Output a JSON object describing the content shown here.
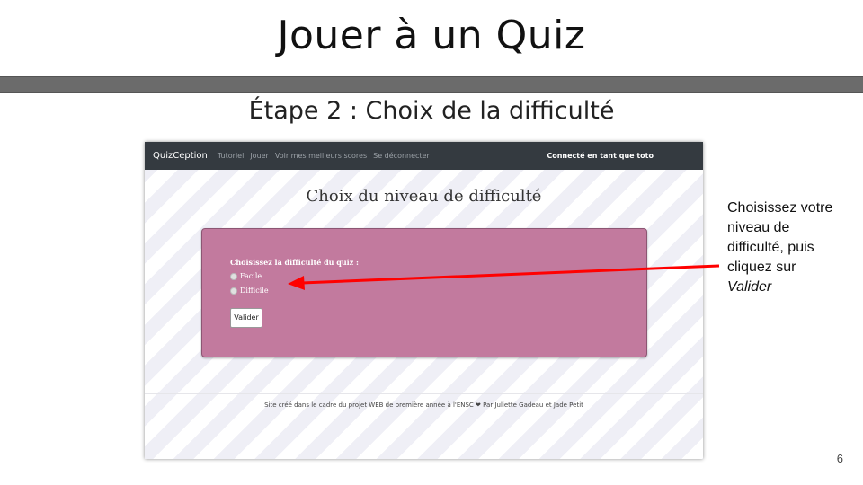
{
  "slide": {
    "title": "Jouer à un Quiz",
    "subtitle": "Étape 2 : Choix de la difficulté",
    "page_number": "6",
    "title_bar_color": "#6b6b6b"
  },
  "app": {
    "navbar": {
      "brand": "QuizCeption",
      "links": [
        "Tutoriel",
        "Jouer",
        "Voir mes meilleurs scores",
        "Se déconnecter"
      ],
      "user_status": "Connecté en tant que toto"
    },
    "heading": "Choix du niveau de difficulté",
    "panel": {
      "question": "Choisissez la difficulté du quiz :",
      "options": [
        "Facile",
        "Difficile"
      ],
      "submit_label": "Valider",
      "background_color": "#c27a9e"
    },
    "footer": "Site créé dans le cadre du projet WEB de première année à l'ENSC ❤ Par Juliette Gadeau et Jade Petit"
  },
  "annotation": {
    "lines": [
      "Choisissez votre",
      "niveau de",
      "difficulté, puis",
      "cliquez sur"
    ],
    "emphasis": "Valider",
    "arrow_color": "#ff0000"
  }
}
